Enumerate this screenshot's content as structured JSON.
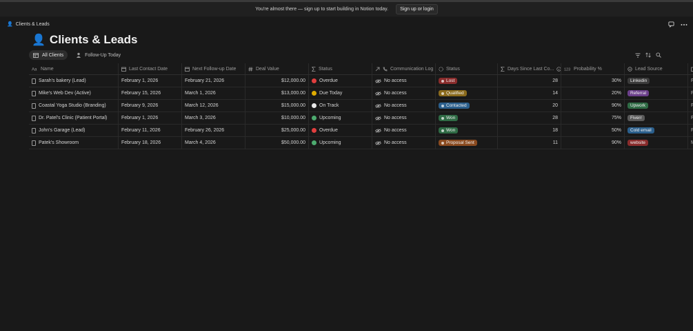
{
  "banner": {
    "text": "You're almost there — sign up to start building in Notion today.",
    "button": "Sign up or login"
  },
  "breadcrumb": {
    "emoji": "👤",
    "label": "Clients & Leads"
  },
  "page": {
    "emoji": "👤",
    "title": "Clients & Leads"
  },
  "tabs": [
    {
      "label": "All Clients",
      "active": true
    },
    {
      "label": "Follow-Up Today",
      "active": false
    }
  ],
  "columns": {
    "name": "Name",
    "last_contact": "Last Contact Date",
    "next_followup": "Next Follow-up Date",
    "deal_value": "Deal Value",
    "status1": "Status",
    "comm_log": "Communication Log",
    "status2": "Status",
    "days_since": "Days Since Last Co...",
    "probability": "Probability %",
    "lead_source": "Lead Source"
  },
  "colors": {
    "Overdue": "#e03e3e",
    "Due Today": "#dfab01",
    "On Track": "#e8e8e8",
    "Upcoming": "#4dab6f",
    "Lost": "#8a2c2c",
    "Qualified": "#8a6a1c",
    "Contacted": "#2b5f8c",
    "Won": "#2f6b45",
    "Proposal Sent": "#8a4a1f",
    "Linkedin": "#3b3b3b",
    "Referral": "#6b3f8a",
    "Upwork": "#2f6b45",
    "Fiverr": "#5a5a5a",
    "Cold email": "#2b5f8c",
    "website": "#8a2c2c"
  },
  "rows": [
    {
      "name": "Sarah's bakery (Lead)",
      "last_contact": "February 1, 2026",
      "next_followup": "February 21, 2026",
      "deal_value": "$12,000.00",
      "status1": "Overdue",
      "comm_log": "No access",
      "status2": "Lost",
      "days_since": "28",
      "probability": "30%",
      "lead_source": "Linkedin",
      "extra": "F"
    },
    {
      "name": "Mike's Web Dev (Active)",
      "last_contact": "February 15, 2026",
      "next_followup": "March 1, 2026",
      "deal_value": "$13,000.00",
      "status1": "Due Today",
      "comm_log": "No access",
      "status2": "Qualified",
      "days_since": "14",
      "probability": "20%",
      "lead_source": "Referral",
      "extra": "F"
    },
    {
      "name": "Coastal Yoga Studio (Branding)",
      "last_contact": "February 9, 2026",
      "next_followup": "March 12, 2026",
      "deal_value": "$15,000.00",
      "status1": "On Track",
      "comm_log": "No access",
      "status2": "Contacted",
      "days_since": "20",
      "probability": "90%",
      "lead_source": "Upwork",
      "extra": "F"
    },
    {
      "name": "Dr. Patel's Clinic (Patient Portal)",
      "last_contact": "February 1, 2026",
      "next_followup": "March 3, 2026",
      "deal_value": "$10,000.00",
      "status1": "Upcoming",
      "comm_log": "No access",
      "status2": "Won",
      "days_since": "28",
      "probability": "75%",
      "lead_source": "Fiverr",
      "extra": "F"
    },
    {
      "name": "John's Garage (Lead)",
      "last_contact": "February 11, 2026",
      "next_followup": "February 26, 2026",
      "deal_value": "$25,000.00",
      "status1": "Overdue",
      "comm_log": "No access",
      "status2": "Won",
      "days_since": "18",
      "probability": "50%",
      "lead_source": "Cold email",
      "extra": "F"
    },
    {
      "name": "Patek's Showroom",
      "last_contact": "February 18, 2026",
      "next_followup": "March 4, 2026",
      "deal_value": "$50,000.00",
      "status1": "Upcoming",
      "comm_log": "No access",
      "status2": "Proposal Sent",
      "days_since": "11",
      "probability": "90%",
      "lead_source": "website",
      "extra": "M"
    }
  ]
}
